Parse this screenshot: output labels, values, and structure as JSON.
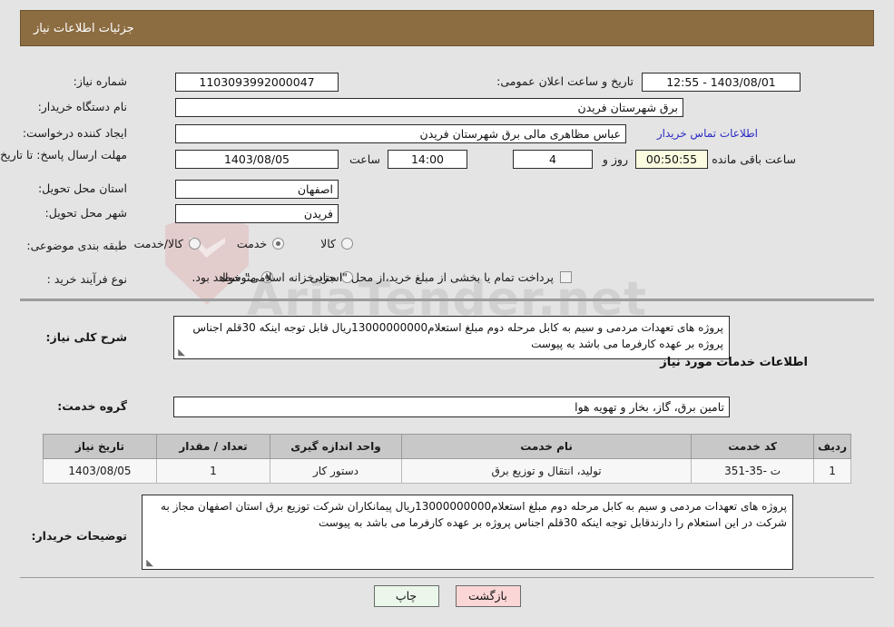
{
  "header": {
    "title": "جزئیات اطلاعات نیاز"
  },
  "watermark": {
    "text": "AriaTender.net"
  },
  "fields": {
    "need_number_label": "شماره نیاز:",
    "need_number_value": "1103093992000047",
    "announce_label": "تاریخ و ساعت اعلان عمومی:",
    "announce_value": "1403/08/01 - 12:55",
    "buyer_org_label": "نام دستگاه خریدار:",
    "buyer_org_value": "برق شهرستان فریدن",
    "creator_label": "ایجاد کننده درخواست:",
    "creator_value": "عباس مظاهری مالی برق شهرستان فریدن",
    "contact_link": "اطلاعات تماس خریدار",
    "deadline_label": "مهلت ارسال پاسخ: تا تاریخ:",
    "deadline_date": "1403/08/05",
    "deadline_hour_label": "ساعت",
    "deadline_hour": "14:00",
    "days_remaining": "4",
    "days_word": "روز و",
    "time_remaining": "00:50:55",
    "remaining_suffix": "ساعت باقی مانده",
    "province_label": "استان محل تحویل:",
    "province_value": "اصفهان",
    "city_label": "شهر محل تحویل:",
    "city_value": "فریدن",
    "category_label": "طبقه بندی موضوعی:",
    "process_label": "نوع فرآیند خرید :",
    "treasury_note": "پرداخت تمام یا بخشی از مبلغ خرید،از محل \"اسناد خزانه اسلامی\" خواهد بود."
  },
  "category_options": [
    {
      "label": "کالا",
      "selected": false
    },
    {
      "label": "خدمت",
      "selected": true
    },
    {
      "label": "کالا/خدمت",
      "selected": false
    }
  ],
  "process_options": [
    {
      "label": "جزیی",
      "selected": false
    },
    {
      "label": "متوسط",
      "selected": true
    }
  ],
  "treasury_checkbox": {
    "checked": false
  },
  "summary": {
    "label": "شرح کلی نیاز:",
    "text": "پروژه های تعهدات مردمی و سیم به کابل مرحله دوم مبلغ استعلام13000000000ریال قابل توجه اینکه 30قلم اجناس پروژه بر عهده کارفرما می باشد به پیوست"
  },
  "services_section": {
    "heading": "اطلاعات خدمات مورد نیاز",
    "group_label": "گروه خدمت:",
    "group_value": "تامین برق، گاز، بخار و تهویه هوا"
  },
  "table": {
    "columns": [
      "ردیف",
      "کد خدمت",
      "نام خدمت",
      "واحد اندازه گیری",
      "تعداد / مقدار",
      "تاریخ نیاز"
    ],
    "rows": [
      [
        "1",
        "ت -35-351",
        "تولید، انتقال و توزیع برق",
        "دستور کار",
        "1",
        "1403/08/05"
      ]
    ]
  },
  "buyer_notes": {
    "label": "توضیحات خریدار:",
    "text": "پروژه های تعهدات مردمی و سیم به کابل مرحله دوم مبلغ استعلام13000000000ریال پیمانکاران شرکت توزیع برق استان اصفهان مجاز به شرکت در این استعلام را دارندقابل توجه اینکه 30قلم اجناس پروژه بر عهده کارفرما می باشد به پیوست"
  },
  "buttons": {
    "print": "چاپ",
    "back": "بازگشت"
  },
  "colors": {
    "header_bg": "#8c6d42",
    "link": "#2b2bc8",
    "print_bg": "#eaf7ea",
    "back_bg": "#fbd6d6"
  }
}
